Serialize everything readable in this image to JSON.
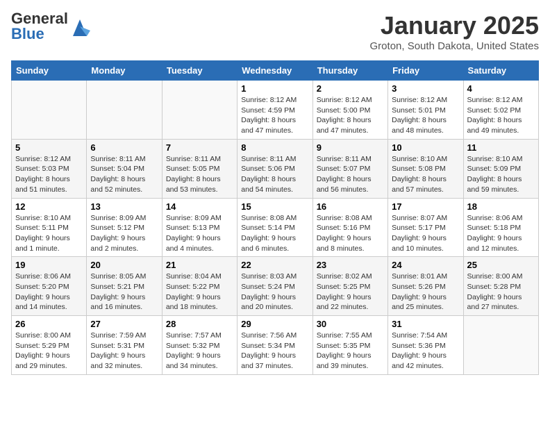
{
  "logo": {
    "general": "General",
    "blue": "Blue"
  },
  "title": "January 2025",
  "subtitle": "Groton, South Dakota, United States",
  "days_of_week": [
    "Sunday",
    "Monday",
    "Tuesday",
    "Wednesday",
    "Thursday",
    "Friday",
    "Saturday"
  ],
  "weeks": [
    [
      {
        "day": "",
        "info": ""
      },
      {
        "day": "",
        "info": ""
      },
      {
        "day": "",
        "info": ""
      },
      {
        "day": "1",
        "sunrise": "Sunrise: 8:12 AM",
        "sunset": "Sunset: 4:59 PM",
        "daylight": "Daylight: 8 hours and 47 minutes."
      },
      {
        "day": "2",
        "sunrise": "Sunrise: 8:12 AM",
        "sunset": "Sunset: 5:00 PM",
        "daylight": "Daylight: 8 hours and 47 minutes."
      },
      {
        "day": "3",
        "sunrise": "Sunrise: 8:12 AM",
        "sunset": "Sunset: 5:01 PM",
        "daylight": "Daylight: 8 hours and 48 minutes."
      },
      {
        "day": "4",
        "sunrise": "Sunrise: 8:12 AM",
        "sunset": "Sunset: 5:02 PM",
        "daylight": "Daylight: 8 hours and 49 minutes."
      }
    ],
    [
      {
        "day": "5",
        "sunrise": "Sunrise: 8:12 AM",
        "sunset": "Sunset: 5:03 PM",
        "daylight": "Daylight: 8 hours and 51 minutes."
      },
      {
        "day": "6",
        "sunrise": "Sunrise: 8:11 AM",
        "sunset": "Sunset: 5:04 PM",
        "daylight": "Daylight: 8 hours and 52 minutes."
      },
      {
        "day": "7",
        "sunrise": "Sunrise: 8:11 AM",
        "sunset": "Sunset: 5:05 PM",
        "daylight": "Daylight: 8 hours and 53 minutes."
      },
      {
        "day": "8",
        "sunrise": "Sunrise: 8:11 AM",
        "sunset": "Sunset: 5:06 PM",
        "daylight": "Daylight: 8 hours and 54 minutes."
      },
      {
        "day": "9",
        "sunrise": "Sunrise: 8:11 AM",
        "sunset": "Sunset: 5:07 PM",
        "daylight": "Daylight: 8 hours and 56 minutes."
      },
      {
        "day": "10",
        "sunrise": "Sunrise: 8:10 AM",
        "sunset": "Sunset: 5:08 PM",
        "daylight": "Daylight: 8 hours and 57 minutes."
      },
      {
        "day": "11",
        "sunrise": "Sunrise: 8:10 AM",
        "sunset": "Sunset: 5:09 PM",
        "daylight": "Daylight: 8 hours and 59 minutes."
      }
    ],
    [
      {
        "day": "12",
        "sunrise": "Sunrise: 8:10 AM",
        "sunset": "Sunset: 5:11 PM",
        "daylight": "Daylight: 9 hours and 1 minute."
      },
      {
        "day": "13",
        "sunrise": "Sunrise: 8:09 AM",
        "sunset": "Sunset: 5:12 PM",
        "daylight": "Daylight: 9 hours and 2 minutes."
      },
      {
        "day": "14",
        "sunrise": "Sunrise: 8:09 AM",
        "sunset": "Sunset: 5:13 PM",
        "daylight": "Daylight: 9 hours and 4 minutes."
      },
      {
        "day": "15",
        "sunrise": "Sunrise: 8:08 AM",
        "sunset": "Sunset: 5:14 PM",
        "daylight": "Daylight: 9 hours and 6 minutes."
      },
      {
        "day": "16",
        "sunrise": "Sunrise: 8:08 AM",
        "sunset": "Sunset: 5:16 PM",
        "daylight": "Daylight: 9 hours and 8 minutes."
      },
      {
        "day": "17",
        "sunrise": "Sunrise: 8:07 AM",
        "sunset": "Sunset: 5:17 PM",
        "daylight": "Daylight: 9 hours and 10 minutes."
      },
      {
        "day": "18",
        "sunrise": "Sunrise: 8:06 AM",
        "sunset": "Sunset: 5:18 PM",
        "daylight": "Daylight: 9 hours and 12 minutes."
      }
    ],
    [
      {
        "day": "19",
        "sunrise": "Sunrise: 8:06 AM",
        "sunset": "Sunset: 5:20 PM",
        "daylight": "Daylight: 9 hours and 14 minutes."
      },
      {
        "day": "20",
        "sunrise": "Sunrise: 8:05 AM",
        "sunset": "Sunset: 5:21 PM",
        "daylight": "Daylight: 9 hours and 16 minutes."
      },
      {
        "day": "21",
        "sunrise": "Sunrise: 8:04 AM",
        "sunset": "Sunset: 5:22 PM",
        "daylight": "Daylight: 9 hours and 18 minutes."
      },
      {
        "day": "22",
        "sunrise": "Sunrise: 8:03 AM",
        "sunset": "Sunset: 5:24 PM",
        "daylight": "Daylight: 9 hours and 20 minutes."
      },
      {
        "day": "23",
        "sunrise": "Sunrise: 8:02 AM",
        "sunset": "Sunset: 5:25 PM",
        "daylight": "Daylight: 9 hours and 22 minutes."
      },
      {
        "day": "24",
        "sunrise": "Sunrise: 8:01 AM",
        "sunset": "Sunset: 5:26 PM",
        "daylight": "Daylight: 9 hours and 25 minutes."
      },
      {
        "day": "25",
        "sunrise": "Sunrise: 8:00 AM",
        "sunset": "Sunset: 5:28 PM",
        "daylight": "Daylight: 9 hours and 27 minutes."
      }
    ],
    [
      {
        "day": "26",
        "sunrise": "Sunrise: 8:00 AM",
        "sunset": "Sunset: 5:29 PM",
        "daylight": "Daylight: 9 hours and 29 minutes."
      },
      {
        "day": "27",
        "sunrise": "Sunrise: 7:59 AM",
        "sunset": "Sunset: 5:31 PM",
        "daylight": "Daylight: 9 hours and 32 minutes."
      },
      {
        "day": "28",
        "sunrise": "Sunrise: 7:57 AM",
        "sunset": "Sunset: 5:32 PM",
        "daylight": "Daylight: 9 hours and 34 minutes."
      },
      {
        "day": "29",
        "sunrise": "Sunrise: 7:56 AM",
        "sunset": "Sunset: 5:34 PM",
        "daylight": "Daylight: 9 hours and 37 minutes."
      },
      {
        "day": "30",
        "sunrise": "Sunrise: 7:55 AM",
        "sunset": "Sunset: 5:35 PM",
        "daylight": "Daylight: 9 hours and 39 minutes."
      },
      {
        "day": "31",
        "sunrise": "Sunrise: 7:54 AM",
        "sunset": "Sunset: 5:36 PM",
        "daylight": "Daylight: 9 hours and 42 minutes."
      },
      {
        "day": "",
        "info": ""
      }
    ]
  ]
}
